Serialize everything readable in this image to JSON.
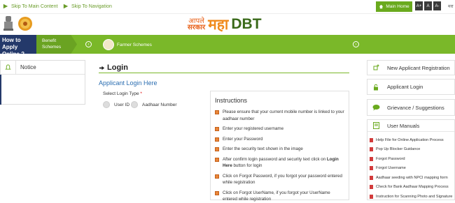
{
  "topbar": {
    "skip_main": "Skip To Main Content",
    "skip_nav": "Skip To Navigation",
    "main_home": "Main Home",
    "font_large": "A+",
    "font_normal": "A",
    "font_small": "A-",
    "lang_label": "मरा"
  },
  "header": {
    "logo_aple": "आपले",
    "logo_sarkar": "सरकार",
    "logo_maha": "महा",
    "logo_dbt": "DBT"
  },
  "nav": {
    "how_to_line1": "How to",
    "how_to_line2": "Apply Online ?",
    "benefit_line1": "Benefit",
    "benefit_line2": "Schemes",
    "farmer_schemes": "Farmer Schemes"
  },
  "notice": {
    "title": "Notice"
  },
  "login": {
    "title": "Login",
    "applicant_title": "Applicant Login Here",
    "select_label": "Select Login Type",
    "required_mark": "*",
    "option_user_id": "User ID",
    "option_aadhaar": "Aadhaar Number"
  },
  "instructions": {
    "title": "Instructions",
    "items": [
      {
        "text": "Please ensure that your current mobile number is linked to your aadhaar number",
        "bold": ""
      },
      {
        "text": "Enter your registered username",
        "bold": ""
      },
      {
        "text": "Enter your Password",
        "bold": ""
      },
      {
        "text": "Enter the security text shown in the image",
        "bold": ""
      },
      {
        "pre": "After confirm login password and security text click on ",
        "bold": "Login Here",
        "post": " button for login"
      },
      {
        "text": "Click on Forgot Password, if you forgot your password entered while registration",
        "bold": ""
      },
      {
        "text": "Click on Forgot UserName, if you forgot your UserName entered while registration",
        "bold": ""
      }
    ]
  },
  "right_panel": {
    "new_registration": "New Applicant Registration",
    "applicant_login": "Applicant Login",
    "grievance": "Grievance / Suggestions",
    "user_manuals": "User Manuals",
    "manuals": [
      "Help File for Online Application Process",
      "Pop Up Blocker Guidance",
      "Forgot Password",
      "Forgot Username",
      "Aadhaar seeding with NPCI mapping form",
      "Check for Bank Aadhaar Mapping Process",
      "Instruction for Scanning Photo and Signature"
    ]
  },
  "colors": {
    "green": "#7ab829",
    "navy": "#24396a",
    "link_blue": "#2a6db0",
    "orange": "#e9863a"
  }
}
